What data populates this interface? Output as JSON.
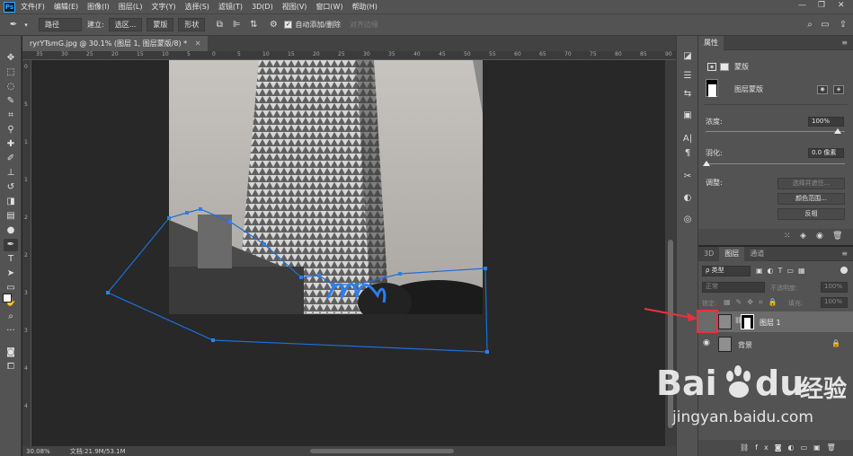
{
  "app": {
    "logo": "Ps"
  },
  "menu": [
    "文件(F)",
    "编辑(E)",
    "图像(I)",
    "图层(L)",
    "文字(Y)",
    "选择(S)",
    "滤镜(T)",
    "3D(D)",
    "视图(V)",
    "窗口(W)",
    "帮助(H)"
  ],
  "window_controls": {
    "minimize": "—",
    "maximize": "❐",
    "close": "✕"
  },
  "options": {
    "mode": "路径",
    "build_label": "建立:",
    "selection_btn": "选区...",
    "mask_btn": "蒙版",
    "shape_btn": "形状",
    "auto_add_delete": "自动添加/删除",
    "align_edges": "对齐边缘"
  },
  "document": {
    "tab_title": "ryrYTsmG.jpg @ 30.1% (图层 1, 图层蒙版/8) *"
  },
  "ruler_top": [
    "35",
    "30",
    "25",
    "20",
    "15",
    "10",
    "5",
    "0",
    "5",
    "10",
    "15",
    "20",
    "25",
    "30",
    "35",
    "40",
    "45",
    "50",
    "55",
    "60",
    "65",
    "70",
    "75",
    "80",
    "85",
    "90",
    "95"
  ],
  "ruler_left": [
    "0",
    "5",
    "1",
    "1",
    "2",
    "2",
    "3",
    "3",
    "4",
    "4"
  ],
  "status": {
    "zoom": "30.08%",
    "doc": "文档:21.9M/53.1M"
  },
  "properties": {
    "title": "属性",
    "mask_type": "蒙版",
    "layer_mask": "图层蒙版",
    "density_label": "浓度:",
    "density_value": "100%",
    "feather_label": "羽化:",
    "feather_value": "0.0 像素",
    "adjust_label": "调整:",
    "select_and_mask": "选择并遮住...",
    "color_range": "颜色范围...",
    "invert": "反相"
  },
  "layers_panel": {
    "tabs": [
      "3D",
      "图层",
      "通道"
    ],
    "filter_kind": "ρ 类型",
    "blend_mode": "正常",
    "opacity_label": "不透明度:",
    "opacity_value": "100%",
    "lock_label": "锁定:",
    "fill_label": "填充:",
    "fill_value": "100%",
    "layers": [
      {
        "name": "图层 1",
        "selected": true,
        "visible": false
      },
      {
        "name": "背景",
        "selected": false,
        "visible": true
      }
    ]
  },
  "watermark": {
    "brand_a": "Bai",
    "brand_b": "du",
    "brand_cn": "经验",
    "url": "jingyan.baidu.com"
  },
  "colors": {
    "accent": "#31a8ff",
    "path": "#1e6fd9",
    "annotation": "#e8323c",
    "panel": "#535353",
    "canvas": "#282828"
  }
}
